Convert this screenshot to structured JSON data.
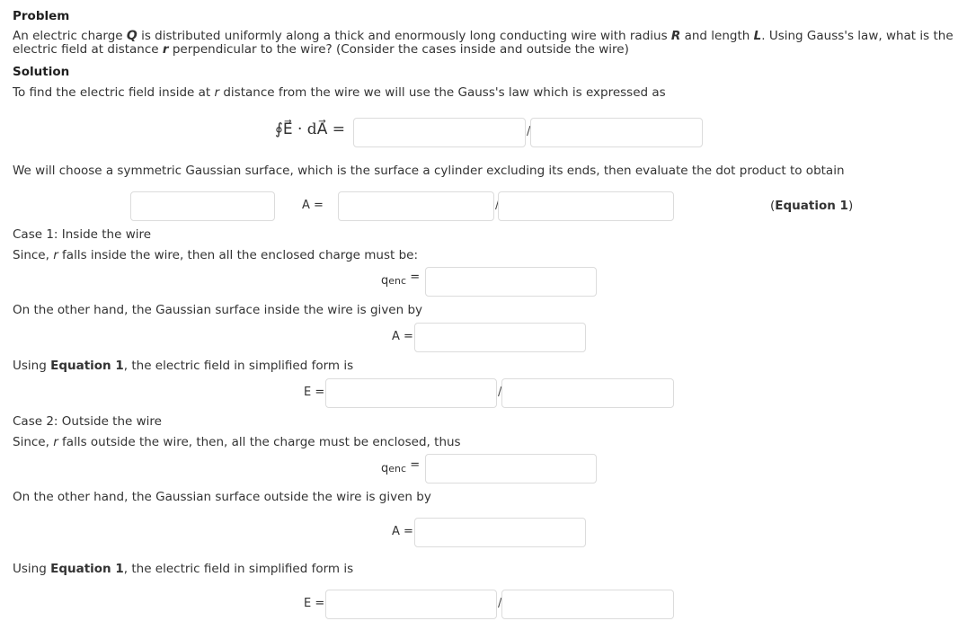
{
  "problem": {
    "heading": "Problem",
    "line1_a": "An electric charge ",
    "line1_Q": "Q",
    "line1_b": " is distributed uniformly along a thick and enormously long conducting wire with radius ",
    "line1_R": "R",
    "line1_c": " and length ",
    "line1_L": "L",
    "line1_d": ". Using Gauss's law, what is the",
    "line2_a": "electric field at distance ",
    "line2_r": "r",
    "line2_b": " perpendicular to the wire? (Consider the cases inside and outside the wire)"
  },
  "solution": {
    "heading": "Solution",
    "intro_a": "To find the electric field inside at ",
    "intro_r": "r",
    "intro_b": " distance from the wire we will use the Gauss's law which is expressed as",
    "gauss_lhs": "∮E⃗ · dA⃗ =",
    "gauss_slash": "/",
    "surface_text": "We will choose a symmetric Gaussian surface, which is the surface a cylinder excluding its ends, then evaluate the dot product to obtain",
    "eq1_label": "A =",
    "eq1_slash": "/",
    "eq1_tag_open": "(",
    "eq1_tag_bold": "Equation 1",
    "eq1_tag_close": ")"
  },
  "case1": {
    "title": "Case 1: Inside the wire",
    "since_a": "Since, ",
    "since_r": "r",
    "since_b": " falls inside the wire, then all the enclosed charge must be:",
    "qenc_q": "q",
    "qenc_sub": "enc",
    "qenc_eq": "=",
    "surface_text": "On the other hand, the Gaussian surface inside the wire is given by",
    "area_label": "A =",
    "using_a": "Using ",
    "using_bold": "Equation 1",
    "using_b": ", the electric field in simplified form is",
    "field_label": "E =",
    "field_slash": "/"
  },
  "case2": {
    "title": "Case 2: Outside the wire",
    "since_a": "Since, ",
    "since_r": "r",
    "since_b": " falls outside the wire, then, all the charge must be enclosed, thus",
    "qenc_q": "q",
    "qenc_sub": "enc",
    "qenc_eq": "=",
    "surface_text": "On the other hand, the Gaussian surface outside the wire is given by",
    "area_label": "A =",
    "using_a": "Using ",
    "using_bold": "Equation 1",
    "using_b": ", the electric field in simplified form is",
    "field_label": "E =",
    "field_slash": "/"
  },
  "inputs": {
    "gauss_numerator": "",
    "gauss_denominator": "",
    "eq1_left": "",
    "eq1_numerator": "",
    "eq1_denominator": "",
    "case1_qenc": "",
    "case1_area": "",
    "case1_field_numerator": "",
    "case1_field_denominator": "",
    "case2_qenc": "",
    "case2_area": "",
    "case2_field_numerator": "",
    "case2_field_denominator": ""
  }
}
